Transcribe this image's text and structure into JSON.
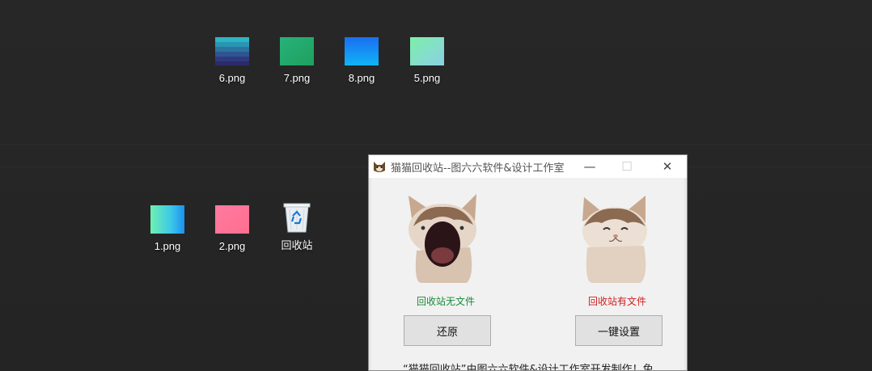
{
  "desktop": {
    "icons_row1": [
      {
        "label": "6.png",
        "icon": "image-thumb-navy-teal"
      },
      {
        "label": "7.png",
        "icon": "image-thumb-green"
      },
      {
        "label": "8.png",
        "icon": "image-thumb-blue"
      },
      {
        "label": "5.png",
        "icon": "image-thumb-mint-cyan"
      }
    ],
    "icons_row2": [
      {
        "label": "1.png",
        "icon": "image-thumb-green-blue"
      },
      {
        "label": "2.png",
        "icon": "image-thumb-pink"
      },
      {
        "label": "回收站",
        "icon": "recycle-bin-icon"
      }
    ]
  },
  "window": {
    "title": "猫猫回收站--图六六软件&设计工作室",
    "minimize_glyph": "—",
    "maximize_glyph": "☐",
    "close_glyph": "✕",
    "empty_status": "回收站无文件",
    "full_status": "回收站有文件",
    "restore_label": "还原",
    "setup_label": "一键设置",
    "footer": "“猫猫回收站”由图六六软件&设计工作室开发制作！免"
  },
  "colors": {
    "empty_status": "#1a8a3a",
    "full_status": "#d02020"
  }
}
